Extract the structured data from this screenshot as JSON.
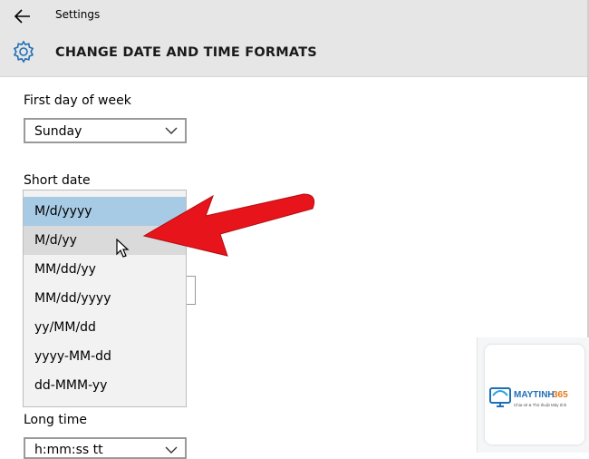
{
  "window": {
    "title": "Settings"
  },
  "header": {
    "title": "CHANGE DATE AND TIME FORMATS"
  },
  "first_day": {
    "label": "First day of week",
    "value": "Sunday"
  },
  "short_date": {
    "label": "Short date",
    "options": [
      "M/d/yyyy",
      "M/d/yy",
      "MM/dd/yy",
      "MM/dd/yyyy",
      "yy/MM/dd",
      "yyyy-MM-dd",
      "dd-MMM-yy"
    ],
    "selected": "M/d/yyyy",
    "hovered": "M/d/yy"
  },
  "long_time": {
    "label": "Long time",
    "value": "h:mm:ss tt"
  },
  "watermark": {
    "brand": "MAYTINH365",
    "tagline": "Chia sẻ & Thủ thuật Máy tính"
  },
  "colors": {
    "selected_bg": "#a8cbe5",
    "hover_bg": "#dadada",
    "arrow": "#e8141b",
    "header_bg": "#e6e6e6"
  },
  "icons": [
    "back-arrow-icon",
    "gear-icon",
    "chevron-down-icon",
    "mouse-cursor-icon",
    "red-arrow-annotation"
  ]
}
